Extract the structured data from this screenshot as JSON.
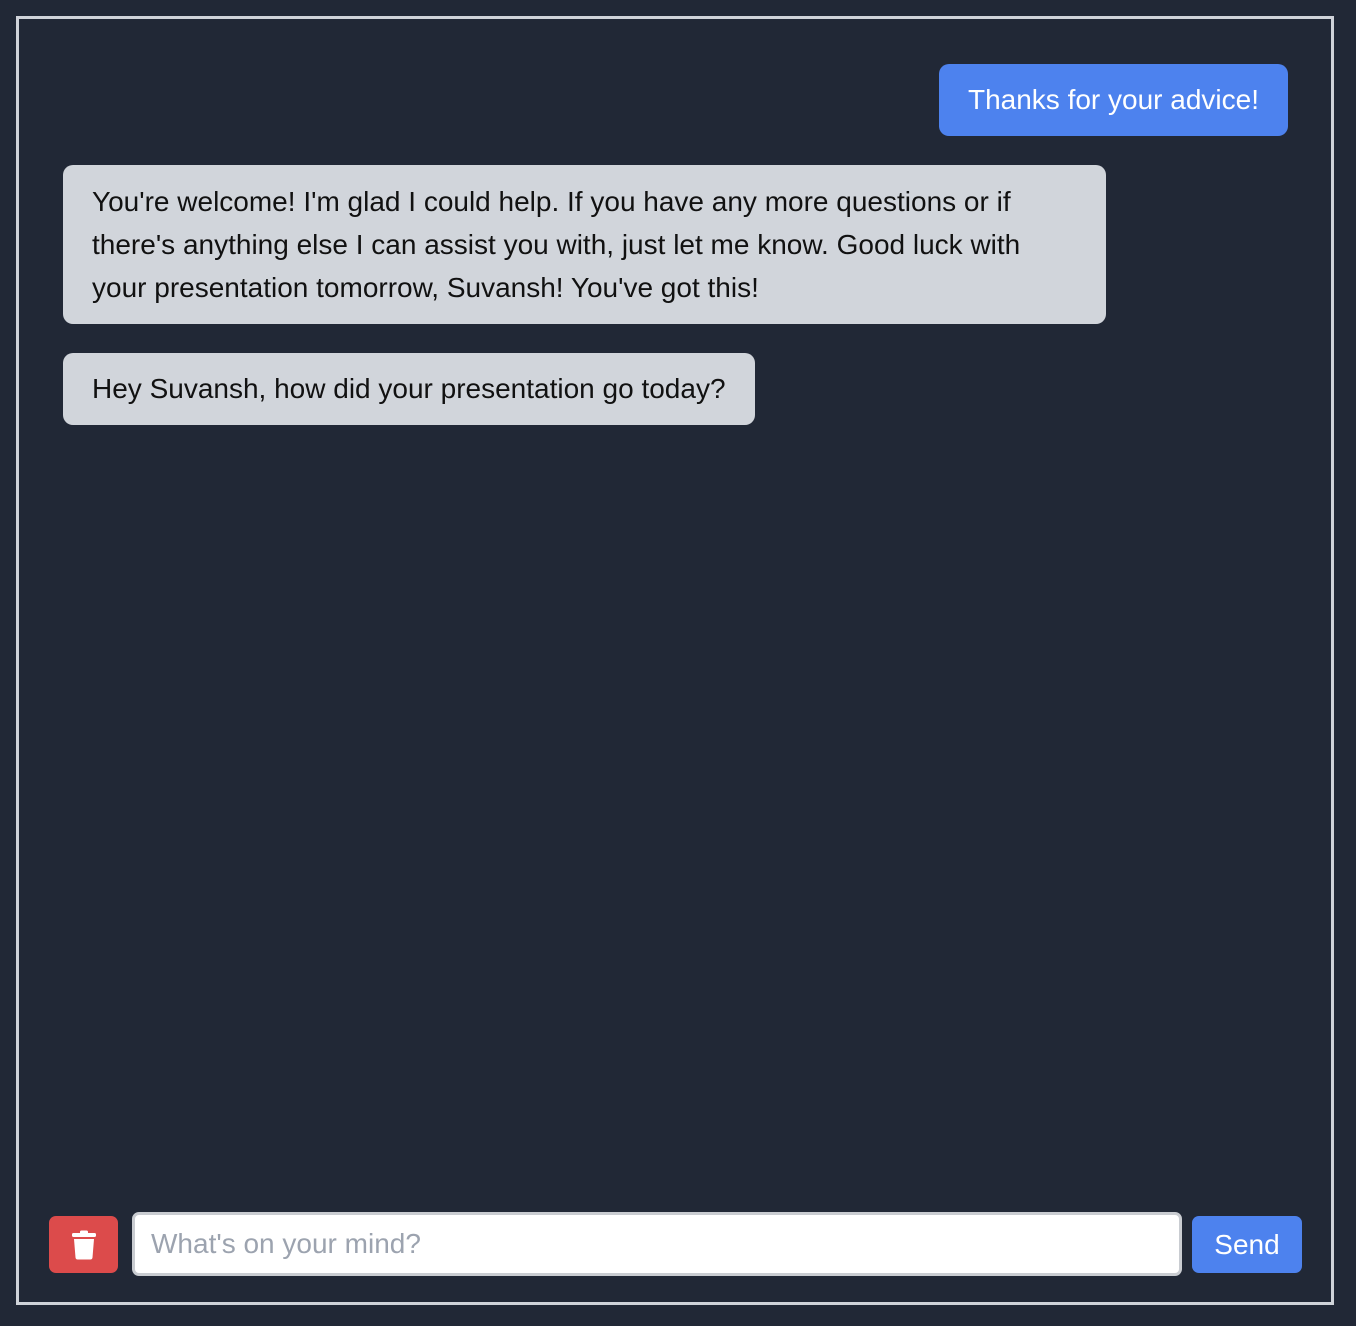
{
  "chat": {
    "messages": [
      {
        "role": "user",
        "text": "Thanks for your advice!"
      },
      {
        "role": "assistant",
        "text": "You're welcome! I'm glad I could help. If you have any more questions or if there's anything else I can assist you with, just let me know. Good luck with your presentation tomorrow, Suvansh! You've got this!"
      },
      {
        "role": "assistant",
        "text": "Hey Suvansh, how did your presentation go today?"
      }
    ]
  },
  "composer": {
    "placeholder": "What's on your mind?",
    "value": "",
    "send_label": "Send",
    "delete_icon": "trash-icon"
  },
  "colors": {
    "background": "#212836",
    "user_bubble": "#4d82ee",
    "assistant_bubble": "#d1d5db",
    "delete_button": "#dc4b4b",
    "send_button": "#4d82ee"
  }
}
